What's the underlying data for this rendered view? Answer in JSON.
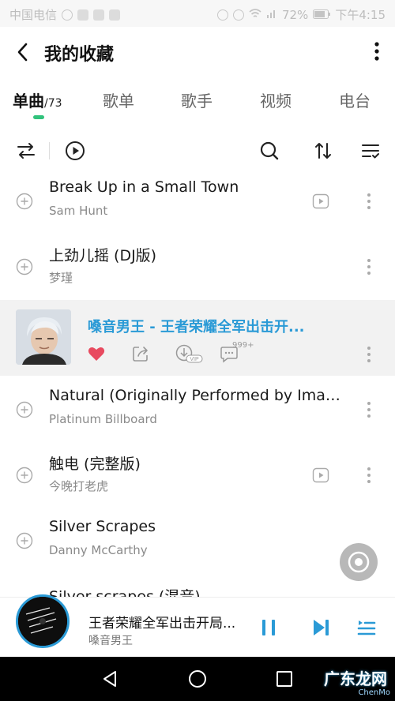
{
  "statusbar": {
    "carrier": "中国电信",
    "battery": "72%",
    "time": "下午4:15"
  },
  "header": {
    "title": "我的收藏"
  },
  "tabs": [
    {
      "label": "单曲",
      "count": "/73"
    },
    {
      "label": "歌单"
    },
    {
      "label": "歌手"
    },
    {
      "label": "视频"
    },
    {
      "label": "电台"
    }
  ],
  "songs": [
    {
      "title": "Break Up in a Small Town",
      "artist": "Sam Hunt",
      "has_mv": true
    },
    {
      "title": "上劲儿摇 (DJ版)",
      "artist": "梦瑾",
      "has_mv": false
    },
    {
      "title": "Natural (Originally Performed by Imagi...",
      "artist": "Platinum Billboard",
      "has_mv": false
    },
    {
      "title": "触电 (完整版)",
      "artist": "今晚打老虎",
      "has_mv": true
    },
    {
      "title": "Silver Scrapes",
      "artist": "Danny McCarthy",
      "has_mv": false
    },
    {
      "title": "Silver scrapes (混音)",
      "artist": "",
      "has_mv": false
    }
  ],
  "playing": {
    "title": "嗓音男王 - 王者荣耀全军出击开...",
    "comment_count": "999+",
    "liked": true
  },
  "player": {
    "title": "王者荣耀全军出击开局...",
    "artist": "嗓音男王"
  },
  "watermark": {
    "text": "广东龙网",
    "sub": "ChenMo"
  },
  "colors": {
    "accent": "#31c27c",
    "playing": "#2a9ad6",
    "like": "#e84a5f"
  }
}
